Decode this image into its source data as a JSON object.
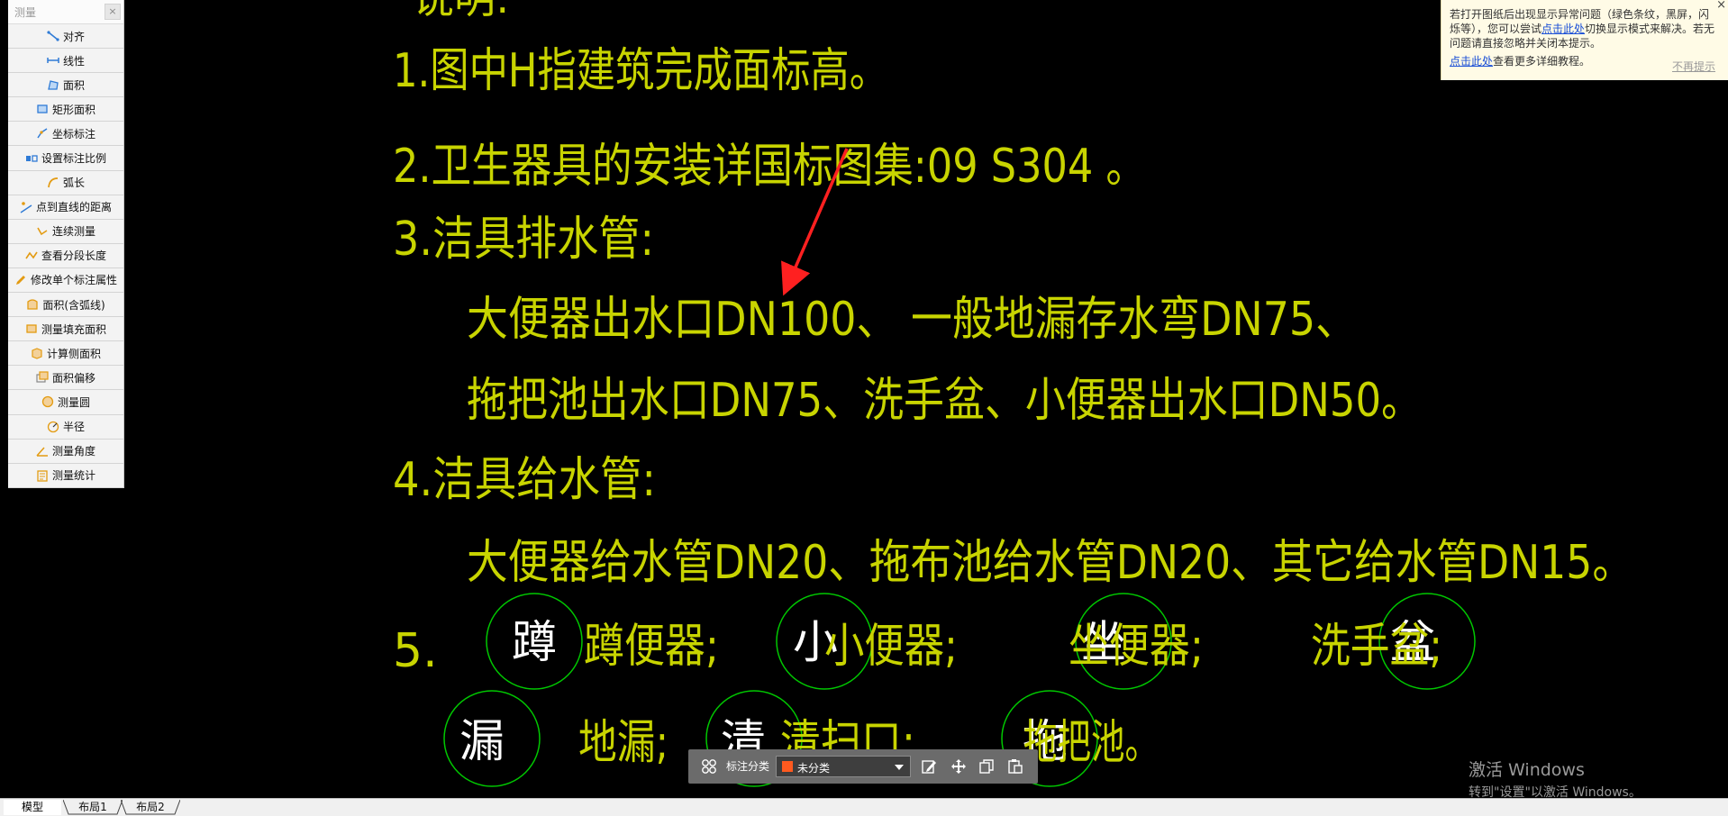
{
  "panel": {
    "title": "测量",
    "close_glyph": "×",
    "tools": [
      {
        "label": "对齐",
        "icon": "align-measure-icon"
      },
      {
        "label": "线性",
        "icon": "linear-measure-icon"
      },
      {
        "label": "面积",
        "icon": "area-measure-icon"
      },
      {
        "label": "矩形面积",
        "icon": "rect-area-icon"
      },
      {
        "label": "坐标标注",
        "icon": "coordinate-icon"
      },
      {
        "label": "设置标注比例",
        "icon": "scale-setting-icon"
      },
      {
        "label": "弧长",
        "icon": "arc-length-icon"
      },
      {
        "label": "点到直线的距离",
        "icon": "point-line-distance-icon"
      },
      {
        "label": "连续测量",
        "icon": "continuous-measure-icon"
      },
      {
        "label": "查看分段长度",
        "icon": "segment-length-icon"
      },
      {
        "label": "修改单个标注属性",
        "icon": "edit-annotation-icon"
      },
      {
        "label": "面积(含弧线)",
        "icon": "arc-area-icon"
      },
      {
        "label": "测量填充面积",
        "icon": "fill-area-icon"
      },
      {
        "label": "计算侧面积",
        "icon": "side-area-icon"
      },
      {
        "label": "面积偏移",
        "icon": "area-offset-icon"
      },
      {
        "label": "测量圆",
        "icon": "measure-circle-icon"
      },
      {
        "label": "半径",
        "icon": "radius-icon"
      },
      {
        "label": "测量角度",
        "icon": "angle-icon"
      },
      {
        "label": "测量统计",
        "icon": "statistics-icon"
      }
    ]
  },
  "notice": {
    "part1": "若打开图纸后出现显示异常问题（绿色条纹，黑屏，闪烁等），您可以尝试",
    "link1": "点击此处",
    "part2": "切换显示模式来解决。若无问题请直接忽略并关闭本提示。",
    "link2": "点击此处",
    "part3": "查看更多详细教程。",
    "no_remind": "不再提示",
    "close_glyph": "×"
  },
  "drawing": {
    "partial_title": "说明:",
    "lines": [
      "1.图中H指建筑完成面标高。",
      "2.卫生器具的安装详国标图集:09 S304 。",
      "3.洁具排水管:",
      "大便器出水口DN100、 一般地漏存水弯DN75、",
      "拖把池出水口DN75、洗手盆、小便器出水口DN50。",
      "4.洁具给水管:",
      "大便器给水管DN20、拖布池给水管DN20、其它给水管DN15。"
    ],
    "item5_number": "5.",
    "legend": [
      {
        "symbol": "蹲",
        "label": "蹲便器;"
      },
      {
        "symbol": "小",
        "label": "小便器;"
      },
      {
        "symbol": "坐",
        "label": "坐便器;"
      },
      {
        "symbol": "盆",
        "label": "洗手盆;"
      },
      {
        "symbol": "漏",
        "label": "地漏;"
      },
      {
        "symbol": "清",
        "label": "清扫口;"
      },
      {
        "symbol": "拖",
        "label": "拖把池。"
      }
    ],
    "text_color": "#c8d400",
    "circle_color": "#00c800",
    "arrow_color": "#ff2020"
  },
  "toolbar": {
    "label": "标注分类",
    "selected": "未分类",
    "swatch_color": "#ff5a1f",
    "icons": [
      "category-grid-icon",
      "edit-icon",
      "move-icon",
      "copy-icon",
      "paste-icon"
    ]
  },
  "watermark": {
    "line1": "激活 Windows",
    "line2": "转到\"设置\"以激活 Windows。"
  },
  "tabs": [
    "模型",
    "布局1",
    "布局2"
  ]
}
